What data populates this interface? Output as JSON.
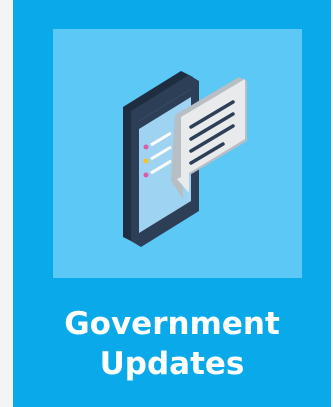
{
  "tile": {
    "title_line1": "Government",
    "title_line2": "Updates",
    "icon": "phone-with-message-bubble-icon",
    "colors": {
      "tile_background": "#0aa9ea",
      "illustration_background": "#5bc8f5",
      "phone_body": "#2d3f57",
      "phone_screen": "#9fd3f2",
      "bubble": "#e8eaec",
      "title_text": "#ffffff"
    }
  }
}
